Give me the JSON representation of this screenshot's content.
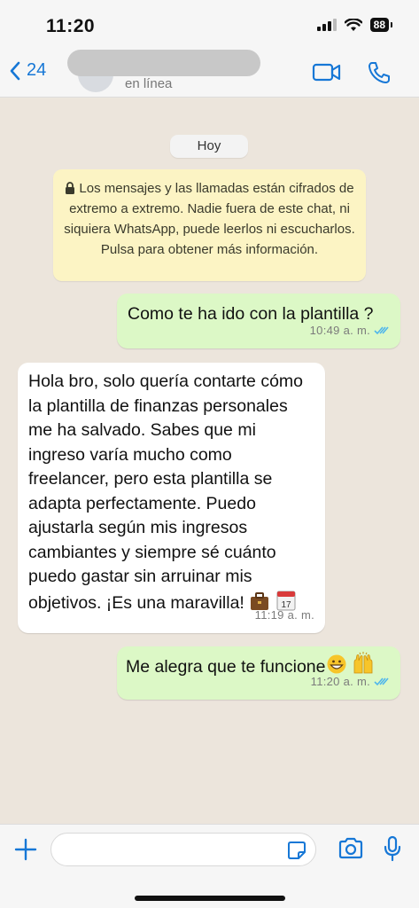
{
  "status_bar": {
    "time": "11:20",
    "battery": "88"
  },
  "header": {
    "back_count": "24",
    "contact_status": "en línea"
  },
  "chat": {
    "date_chip": "Hoy",
    "notice": "Los mensajes y las llamadas están cifrados de extremo a extremo. Nadie fuera de este chat, ni siquiera WhatsApp, puede leerlos ni escucharlos. Pulsa para obtener más información.",
    "messages": [
      {
        "direction": "out",
        "text": "Como te ha ido con la plantilla ?",
        "time": "10:49 a. m.",
        "read": true
      },
      {
        "direction": "in",
        "text": "Hola bro, solo quería contarte cómo la plantilla de finanzas personales me ha salvado. Sabes que mi ingreso varía mucho como freelancer, pero esta plantilla se adapta perfectamente. Puedo ajustarla según mis ingresos cambiantes y siempre sé cuánto puedo gastar sin arruinar mis objetivos. ¡Es una maravilla!",
        "emojis": [
          "briefcase",
          "calendar"
        ],
        "calendar_day": "17",
        "time": "11:19 a. m."
      },
      {
        "direction": "out",
        "text": "Me alegra que te funcione",
        "emojis": [
          "grinning-face",
          "raising-hands"
        ],
        "time": "11:20 a. m.",
        "read": true
      }
    ]
  },
  "input_bar": {
    "message_placeholder": ""
  },
  "colors": {
    "accent": "#1677d6",
    "outgoing_bubble": "#dcf8c6",
    "incoming_bubble": "#ffffff",
    "notice_bg": "#fcf4c4",
    "read_ticks": "#4fb6ec"
  }
}
